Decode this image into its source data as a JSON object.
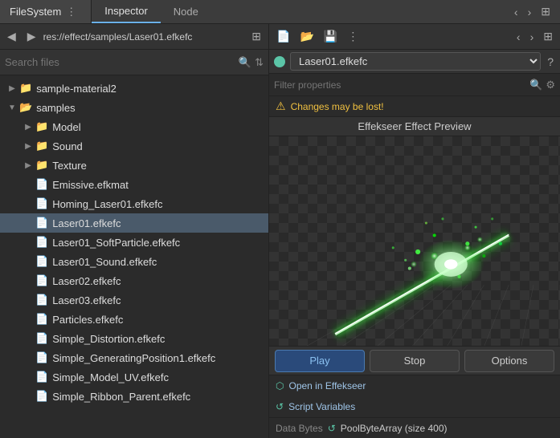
{
  "topbar": {
    "filesystem_label": "FileSystem",
    "inspector_tab": "Inspector",
    "node_tab": "Node"
  },
  "path_bar": {
    "path": "res://effect/samples/Laser01.efkefc",
    "back_arrow": "◀",
    "forward_arrow": "▶",
    "layout_icon": "⊞"
  },
  "search": {
    "placeholder": "Search files",
    "search_icon": "🔍",
    "sort_icon": "⇅"
  },
  "file_tree": {
    "items": [
      {
        "id": "sample-material2",
        "label": "sample-material2",
        "type": "folder",
        "indent": 1,
        "expanded": false,
        "arrow": "▶"
      },
      {
        "id": "samples",
        "label": "samples",
        "type": "folder",
        "indent": 1,
        "expanded": true,
        "arrow": "▼"
      },
      {
        "id": "Model",
        "label": "Model",
        "type": "folder",
        "indent": 2,
        "expanded": false,
        "arrow": "▶"
      },
      {
        "id": "Sound",
        "label": "Sound",
        "type": "folder",
        "indent": 2,
        "expanded": false,
        "arrow": "▶"
      },
      {
        "id": "Texture",
        "label": "Texture",
        "type": "folder",
        "indent": 2,
        "expanded": false,
        "arrow": "▶"
      },
      {
        "id": "Emissive.efkmat",
        "label": "Emissive.efkmat",
        "type": "file",
        "indent": 2
      },
      {
        "id": "Homing_Laser01.efkefc",
        "label": "Homing_Laser01.efkefc",
        "type": "file",
        "indent": 2
      },
      {
        "id": "Laser01.efkefc",
        "label": "Laser01.efkefc",
        "type": "file",
        "indent": 2,
        "selected": true
      },
      {
        "id": "Laser01_SoftParticle.efkefc",
        "label": "Laser01_SoftParticle.efkefc",
        "type": "file",
        "indent": 2
      },
      {
        "id": "Laser01_Sound.efkefc",
        "label": "Laser01_Sound.efkefc",
        "type": "file",
        "indent": 2
      },
      {
        "id": "Laser02.efkefc",
        "label": "Laser02.efkefc",
        "type": "file",
        "indent": 2
      },
      {
        "id": "Laser03.efkefc",
        "label": "Laser03.efkefc",
        "type": "file",
        "indent": 2
      },
      {
        "id": "Particles.efkefc",
        "label": "Particles.efkefc",
        "type": "file",
        "indent": 2
      },
      {
        "id": "Simple_Distortion.efkefc",
        "label": "Simple_Distortion.efkefc",
        "type": "file",
        "indent": 2
      },
      {
        "id": "Simple_GeneratingPosition1.efkefc",
        "label": "Simple_GeneratingPosition1.efkefc",
        "type": "file",
        "indent": 2
      },
      {
        "id": "Simple_Model_UV.efkefc",
        "label": "Simple_Model_UV.efkefc",
        "type": "file",
        "indent": 2
      },
      {
        "id": "Simple_Ribbon_Parent.efkefc",
        "label": "Simple_Ribbon_Parent.efkefc",
        "type": "file",
        "indent": 2
      }
    ]
  },
  "inspector": {
    "resource_name": "Laser01.efkefc",
    "filter_placeholder": "Filter properties",
    "warning_text": "Changes may be lost!",
    "preview_title": "Effekseer Effect Preview",
    "play_label": "Play",
    "stop_label": "Stop",
    "options_label": "Options",
    "open_effekseer_label": "Open in Effekseer",
    "script_variables_label": "Script Variables",
    "data_bytes_label": "Data Bytes",
    "data_bytes_value": "PoolByteArray (size 400)"
  },
  "icons": {
    "new": "📄",
    "open": "📂",
    "save": "💾",
    "menu": "⋮",
    "arrow_left": "‹",
    "arrow_right": "›",
    "expand": "⊞",
    "search": "🔍",
    "filter": "⚙",
    "warning": "⚠",
    "circle_link": "🔗",
    "doc": "?",
    "back": "◁",
    "forward": "▷"
  }
}
